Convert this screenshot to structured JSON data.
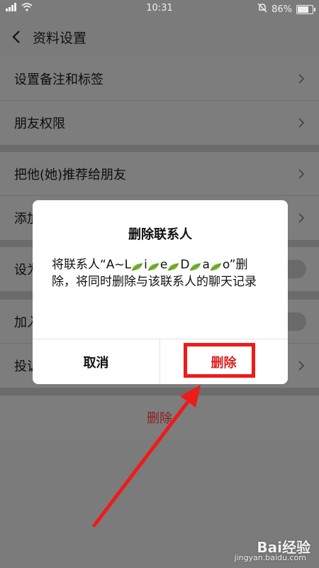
{
  "status_bar": {
    "time": "10:31",
    "battery": "86%",
    "battery_level": 0.86
  },
  "header": {
    "title": "资料设置"
  },
  "settings": {
    "group1": [
      {
        "label": "设置备注和标签"
      },
      {
        "label": "朋友权限"
      }
    ],
    "group2": [
      {
        "label": "把他(她)推荐给朋友"
      },
      {
        "label": "添加"
      }
    ],
    "group3": [
      {
        "label": "设为"
      }
    ],
    "group4": [
      {
        "label": "加入"
      },
      {
        "label": "投诉"
      }
    ],
    "delete_label": "删除"
  },
  "dialog": {
    "title": "删除联系人",
    "message_prefix": "将联系人“A~L",
    "message_parts": [
      "i",
      "e",
      "D",
      "a",
      "o”删除，将同时删除与该联系人的聊天记录"
    ],
    "cancel_label": "取消",
    "confirm_label": "删除"
  },
  "watermark": {
    "brand": "Bai经验",
    "url": "jingyan.baidu.com"
  },
  "colors": {
    "highlight": "#ee1b1b",
    "danger": "#e02020",
    "leaf": "#7fb83a"
  }
}
